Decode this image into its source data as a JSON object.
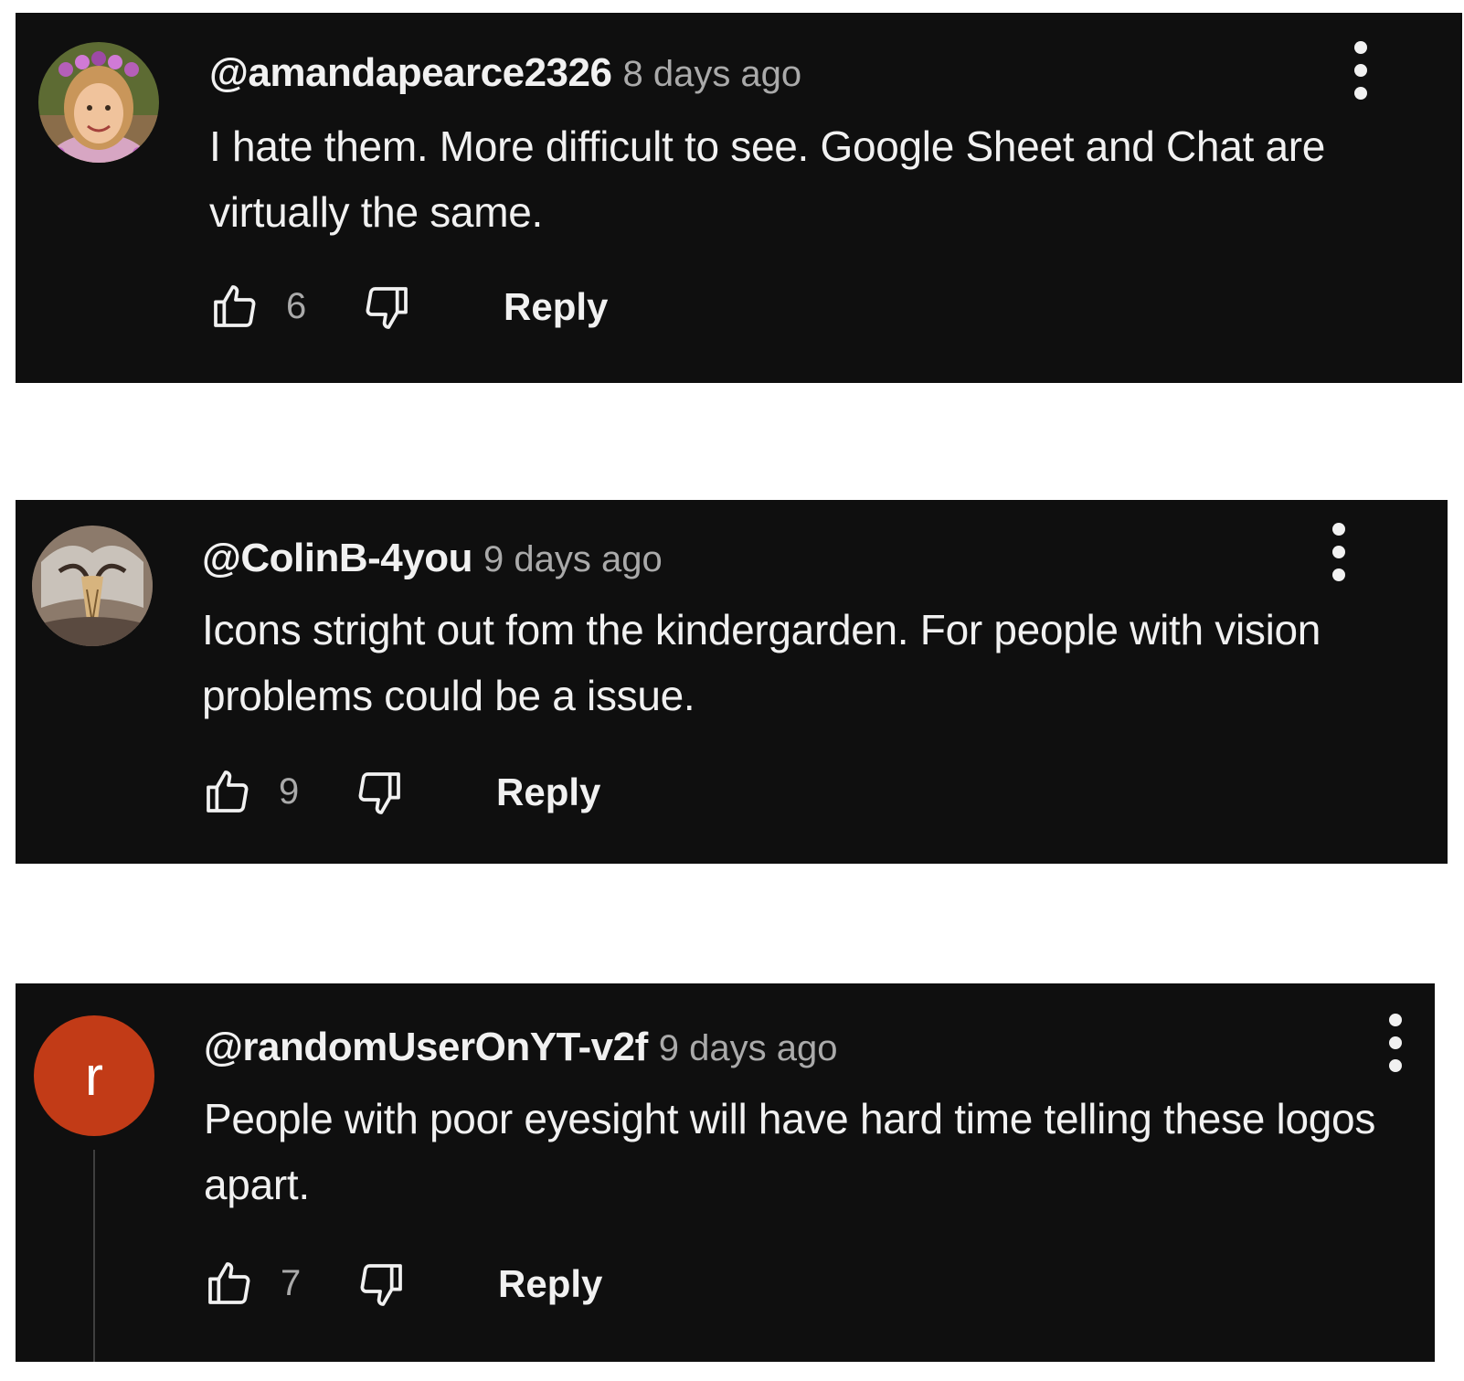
{
  "comments": [
    {
      "handle": "@amandapearce2326",
      "time": "8 days ago",
      "text": "I hate them. More difficult to see.  Google Sheet and Chat are virtually the same.",
      "likes": "6",
      "reply_label": "Reply"
    },
    {
      "handle": "@ColinB-4you",
      "time": "9 days ago",
      "text": "Icons stright out fom the kindergarden. For people with vision problems could be a issue.",
      "likes": "9",
      "reply_label": "Reply"
    },
    {
      "handle": "@randomUserOnYT-v2f",
      "time": "9 days ago",
      "text": "People with poor eyesight will have hard time telling these logos apart.",
      "likes": "7",
      "reply_label": "Reply",
      "avatar_letter": "r",
      "avatar_color": "#c23b17"
    }
  ],
  "colors": {
    "background": "#0f0f0f",
    "text": "#f1f1f1",
    "secondary_text": "#aaaaaa"
  }
}
